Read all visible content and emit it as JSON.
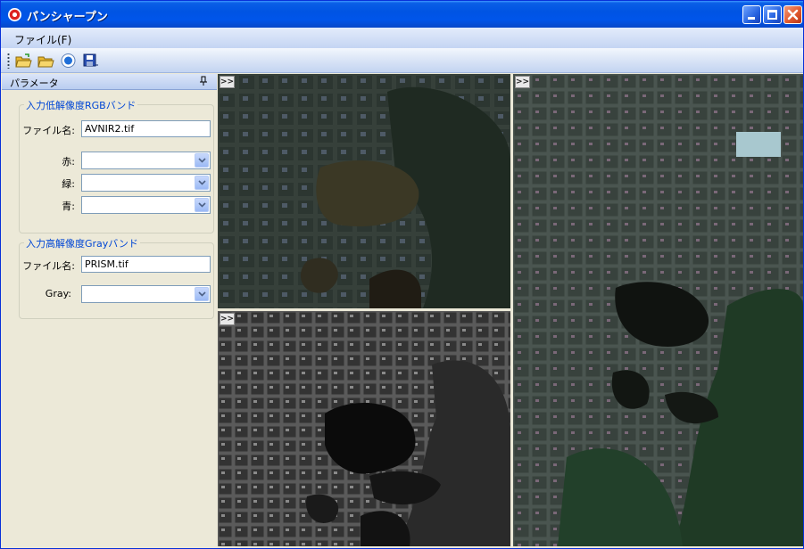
{
  "window": {
    "title": "パンシャープン"
  },
  "menu": {
    "file": "ファイル(F)"
  },
  "toolbar": {
    "buttons": [
      "open-folder-icon",
      "open-file-icon",
      "run-icon",
      "save-icon"
    ]
  },
  "panel": {
    "title": "パラメータ",
    "low_res_group": {
      "title": "入力低解像度RGBバンド",
      "file_label": "ファイル名:",
      "file_value": "AVNIR2.tif",
      "red_label": "赤:",
      "green_label": "緑:",
      "blue_label": "青:",
      "red_value": "",
      "green_value": "",
      "blue_value": ""
    },
    "high_res_group": {
      "title": "入力高解像度Grayバンド",
      "file_label": "ファイル名:",
      "file_value": "PRISM.tif",
      "gray_label": "Gray:",
      "gray_value": ""
    }
  },
  "views": {
    "expand_label": ">>"
  },
  "colors": {
    "title_bar": "#0054e3",
    "group_title": "#0046d5"
  }
}
